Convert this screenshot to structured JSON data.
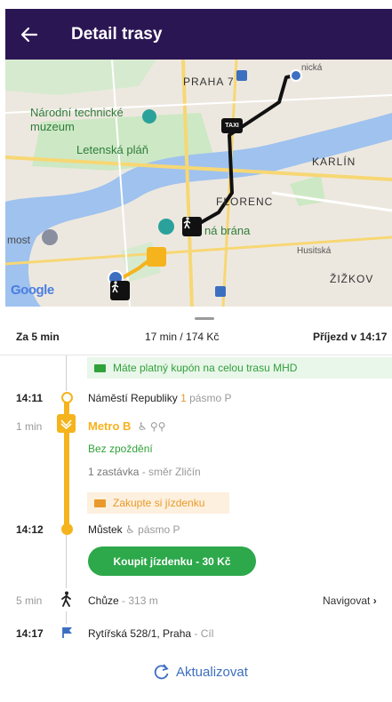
{
  "appbar": {
    "title": "Detail trasy",
    "back_icon": "arrow-left-icon"
  },
  "map": {
    "labels": {
      "praha7": "PRAHA 7",
      "museum": "Národní technické\nmuzeum",
      "letenska": "Letenská pláň",
      "karlin": "KARLÍN",
      "florenc": "FLORENC",
      "brana": "ná brána",
      "most": "most",
      "husitska": "Husitská",
      "zizkov": "ŽIŽKOV",
      "nicka": "nická"
    },
    "google": "Google",
    "taxi_label": "TAXI",
    "colors": {
      "route": "#111111",
      "metro": "#f5b31d",
      "water": "#9fc2ef",
      "park": "#cde8c4",
      "road": "#f7d774"
    }
  },
  "summary": {
    "left": "Za 5 min",
    "middle": "17 min / 174 Kč",
    "right": "Příjezd v 14:17"
  },
  "coupon_banner": "Máte platný kupón na celou trasu MHD",
  "stop_start": {
    "time": "14:11",
    "name": "Náměstí Republiky",
    "zone_num": "1",
    "zone_label": "pásmo P"
  },
  "metro": {
    "duration": "1 min",
    "line": "Metro B",
    "status": "Bez zpoždění",
    "stops": "1 zastávka",
    "direction": "- směr Zličín",
    "ticket_banner": "Zakupte si jízdenku"
  },
  "stop_end": {
    "time": "14:12",
    "name": "Můstek",
    "zone_label": "pásmo P"
  },
  "buy_button": "Koupit jízdenku - 30 Kč",
  "walk": {
    "duration": "5 min",
    "mode": "Chůze",
    "distance": "- 313 m",
    "navigate": "Navigovat"
  },
  "destination": {
    "time": "14:17",
    "address": "Rytířská 528/1, Praha",
    "suffix": "- Cíl"
  },
  "refresh_label": "Aktualizovat",
  "colors": {
    "header": "#2b1654",
    "metro": "#f5b31d",
    "green": "#31a13a",
    "link": "#3d6fc1"
  }
}
